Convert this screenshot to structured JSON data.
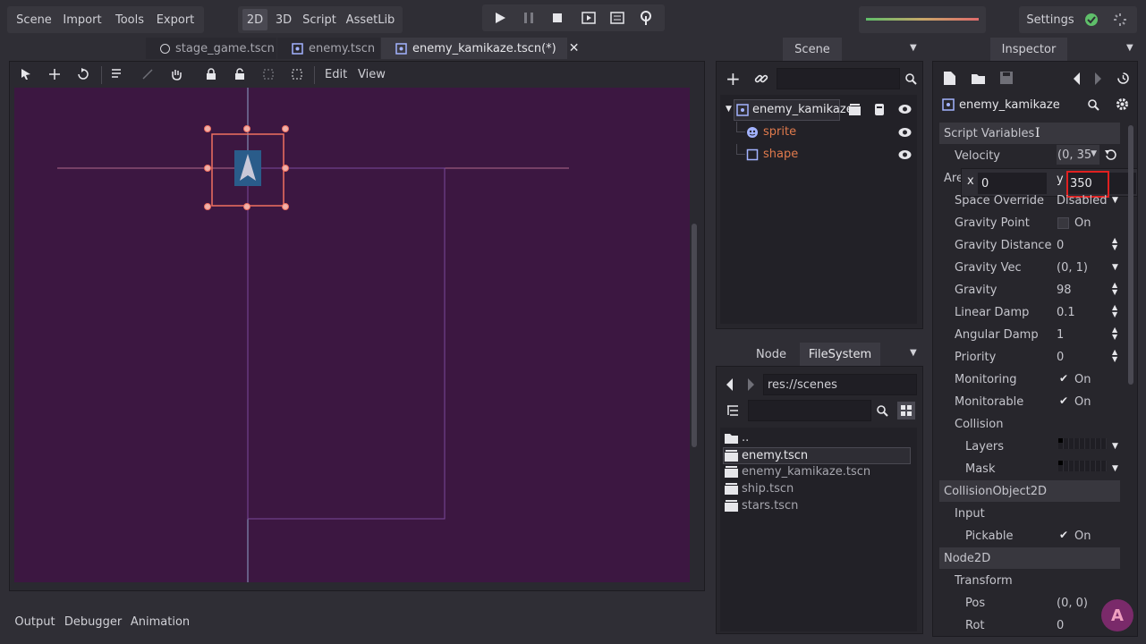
{
  "menu": {
    "scene": "Scene",
    "import": "Import",
    "tools": "Tools",
    "export": "Export"
  },
  "modes": {
    "d2": "2D",
    "d3": "3D",
    "script": "Script",
    "assetlib": "AssetLib"
  },
  "settings_label": "Settings",
  "tabs": [
    {
      "label": "stage_game.tscn"
    },
    {
      "label": "enemy.tscn"
    },
    {
      "label": "enemy_kamikaze.tscn(*)"
    }
  ],
  "viewport_menu": {
    "edit": "Edit",
    "view": "View"
  },
  "bottom_tabs": {
    "output": "Output",
    "debugger": "Debugger",
    "animation": "Animation"
  },
  "scene_dock": {
    "title": "Scene",
    "nodes": [
      {
        "label": "enemy_kamikaze"
      },
      {
        "label": "sprite"
      },
      {
        "label": "shape"
      }
    ]
  },
  "fs_dock": {
    "tab_node": "Node",
    "tab_fs": "FileSystem",
    "path": "res://scenes",
    "files": [
      {
        "label": ".."
      },
      {
        "label": "enemy.tscn"
      },
      {
        "label": "enemy_kamikaze.tscn"
      },
      {
        "label": "ship.tscn"
      },
      {
        "label": "stars.tscn"
      }
    ]
  },
  "inspector": {
    "title": "Inspector",
    "node_name": "enemy_kamikaze",
    "script_vars": "Script Variables",
    "velocity_label": "Velocity",
    "velocity_value": "(0, 35",
    "popup_x_label": "x",
    "popup_x_value": "0",
    "popup_y_label": "y",
    "popup_y_value": "350",
    "area_label": "Are",
    "props": [
      {
        "label": "Space Override",
        "value": "Disabled"
      },
      {
        "label": "Gravity Point",
        "value": "On"
      },
      {
        "label": "Gravity Distance Sc",
        "value": "0"
      },
      {
        "label": "Gravity Vec",
        "value": "(0, 1)"
      },
      {
        "label": "Gravity",
        "value": "98"
      },
      {
        "label": "Linear Damp",
        "value": "0.1"
      },
      {
        "label": "Angular Damp",
        "value": "1"
      },
      {
        "label": "Priority",
        "value": "0"
      },
      {
        "label": "Monitoring",
        "value": "On"
      },
      {
        "label": "Monitorable",
        "value": "On"
      }
    ],
    "collision": "Collision",
    "layers": "Layers",
    "mask": "Mask",
    "collision_obj": "CollisionObject2D",
    "input": "Input",
    "pickable": "Pickable",
    "pickable_value": "On",
    "node2d": "Node2D",
    "transform": "Transform",
    "pos": "Pos",
    "pos_value": "(0, 0)",
    "rot": "Rot",
    "rot_value": "0"
  },
  "colors": {
    "accent": "#e06c4c",
    "viewport_bg": "#3c1741",
    "selection": "#f07060"
  }
}
